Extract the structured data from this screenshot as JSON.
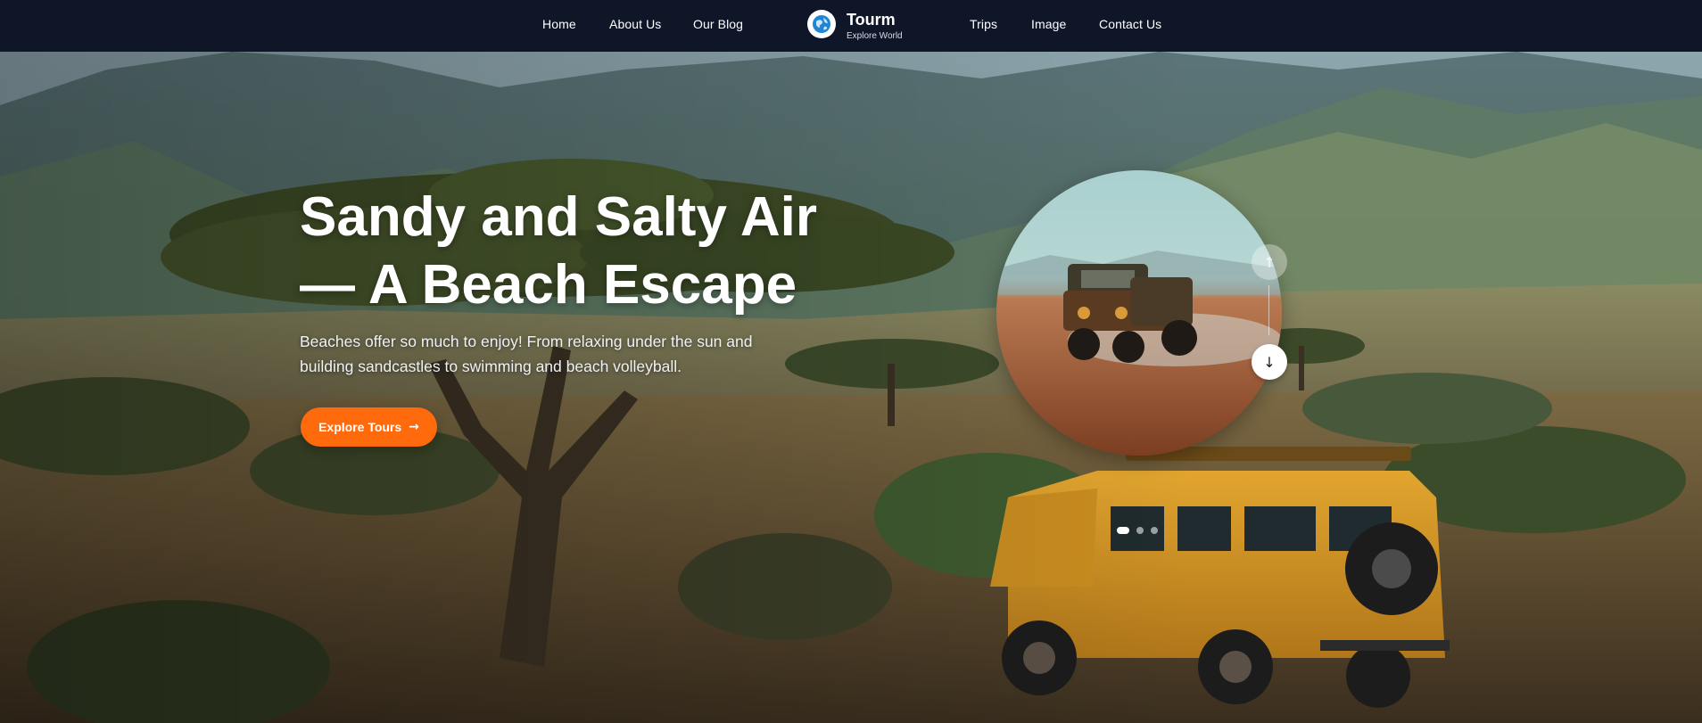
{
  "nav": {
    "links_left": [
      "Home",
      "About Us",
      "Our Blog"
    ],
    "links_right": [
      "Trips",
      "Image",
      "Contact Us"
    ],
    "brand": {
      "name": "Tourm",
      "tagline": "Explore World",
      "icon": "globe-icon"
    }
  },
  "hero": {
    "title_line1": "Sandy and Salty Air",
    "title_line2": "— A Beach Escape",
    "description": "Beaches offer so much to enjoy! From relaxing under the sun and building sandcastles to swimming and beach volleyball.",
    "cta_label": "Explore Tours",
    "cta_icon": "arrow-right-icon",
    "arrow_up_glyph": "↑",
    "arrow_down_glyph": "↓",
    "slides_total": 3,
    "slide_active": 1
  },
  "colors": {
    "nav_bg": "#0e1628",
    "accent": "#ff6a0d",
    "text": "#ffffff"
  }
}
